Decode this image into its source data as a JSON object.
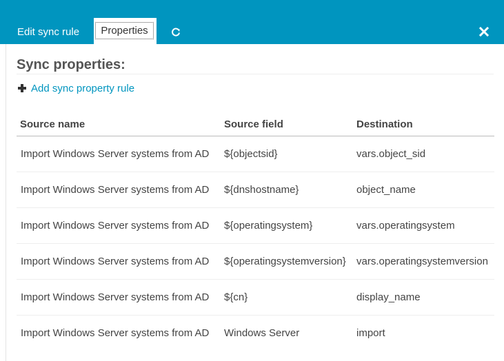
{
  "tabs": {
    "edit_label": "Edit sync rule",
    "properties_label": "Properties"
  },
  "icons": {
    "refresh": "refresh-icon",
    "close": "close-icon",
    "add": "plus-icon"
  },
  "colors": {
    "accent": "#0095bf",
    "text": "#333333"
  },
  "main": {
    "heading": "Sync properties:",
    "add_rule_label": "Add sync property rule"
  },
  "table": {
    "headers": [
      "Source name",
      "Source field",
      "Destination"
    ],
    "rows": [
      {
        "source_name": "Import Windows Server systems from AD",
        "source_field": "${objectsid}",
        "destination": "vars.object_sid"
      },
      {
        "source_name": "Import Windows Server systems from AD",
        "source_field": "${dnshostname}",
        "destination": "object_name"
      },
      {
        "source_name": "Import Windows Server systems from AD",
        "source_field": "${operatingsystem}",
        "destination": "vars.operatingsystem"
      },
      {
        "source_name": "Import Windows Server systems from AD",
        "source_field": "${operatingsystemversion}",
        "destination": "vars.operatingsystemversion"
      },
      {
        "source_name": "Import Windows Server systems from AD",
        "source_field": "${cn}",
        "destination": "display_name"
      },
      {
        "source_name": "Import Windows Server systems from AD",
        "source_field": "Windows Server",
        "destination": "import"
      }
    ]
  }
}
